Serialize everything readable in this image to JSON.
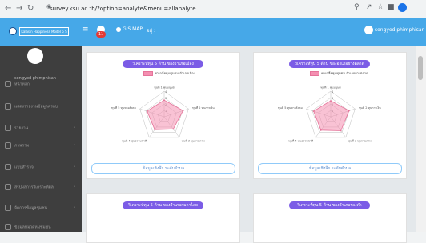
{
  "browser": {
    "url": "survey.ksu.ac.th/?option=analyte&menu=allanalyte"
  },
  "appbar": {
    "brand": "Kalasin Happiness Model 5 S",
    "notification_count": "11",
    "gis_label": "GIS MAP",
    "user_menu": "อยู่ :",
    "user_name": "songyod phimphisan"
  },
  "sidebar": {
    "user": "songyod phimphisan",
    "items": [
      {
        "label": "หน้าหลัก",
        "has_children": false
      },
      {
        "label": "แสดงรายงานข้อมูลครอบ",
        "has_children": false
      },
      {
        "label": "รายงาน",
        "has_children": true
      },
      {
        "label": "ภาพรวม",
        "has_children": true
      },
      {
        "label": "แบบสำรวจ",
        "has_children": true
      },
      {
        "label": "สรุปผลการวิเคราะห์ผล",
        "has_children": true
      },
      {
        "label": "จัดการข้อมูลชุมชน",
        "has_children": true
      },
      {
        "label": "ข้อมูลหมวดหมู่ชุมชน",
        "has_children": false
      }
    ]
  },
  "cards": [
    {
      "title": "วิเคราะห์ทุน 5 ด้าน ของอำเภอเมือง",
      "legend": "ค่าเฉลี่ยทุนชุมชน อำเภอเมือง",
      "button": "ข้อมูลเชิงลึก ระดับตำบล"
    },
    {
      "title": "วิเคราะห์ทุน 5 ด้าน ของอำเภอยางตลาด",
      "legend": "ค่าเฉลี่ยทุนชุมชน อำเภอยางตลาด",
      "button": "ข้อมูลเชิงลึก ระดับตำบล"
    },
    {
      "title": "วิเคราะห์ทุน 5 ด้าน ของอำเภอกมลาไสย",
      "legend": "",
      "button": ""
    },
    {
      "title": "วิเคราะห์ทุน 5 ด้าน ของอำเภอร่องคำ",
      "legend": "",
      "button": ""
    }
  ],
  "chart_data": [
    {
      "type": "radar",
      "axes": [
        "ทุนที่ 1 ทุนมนุษย์",
        "ทุนที่ 2 ทุนการเงิน",
        "ทุนที่ 3 ทุนกายภาพ",
        "ทุนที่ 4 ทุนธรรมชาติ",
        "ทุนที่ 5 ทุนทางสังคม"
      ],
      "rmax": 4,
      "ticks": [
        "1",
        "2",
        "3",
        "4"
      ],
      "series": [
        {
          "name": "ค่าเฉลี่ยทุนชุมชน อำเภอเมือง",
          "values": [
            2.6,
            3.1,
            2.4,
            2.5,
            2.8
          ],
          "color": "#f48fb1"
        }
      ]
    },
    {
      "type": "radar",
      "axes": [
        "ทุนที่ 1 ทุนมนุษย์",
        "ทุนที่ 2 ทุนการเงิน",
        "ทุนที่ 3 ทุนกายภาพ",
        "ทุนที่ 4 ทุนธรรมชาติ",
        "ทุนที่ 5 ทุนทางสังคม"
      ],
      "rmax": 4,
      "ticks": [
        "1",
        "2",
        "3",
        "4"
      ],
      "series": [
        {
          "name": "ค่าเฉลี่ยทุนชุมชน อำเภอยางตลาด",
          "values": [
            2.5,
            3.0,
            2.7,
            2.6,
            2.8
          ],
          "color": "#f48fb1"
        }
      ]
    }
  ]
}
